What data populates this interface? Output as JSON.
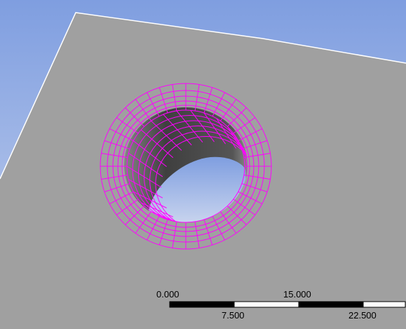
{
  "viewport": {
    "name": "3D graphics view",
    "colors": {
      "background_top": "#7f9ee0",
      "background_bottom": "#c8d4ee",
      "body_face": "#a0a0a0",
      "body_edge": "#ffffff",
      "hole_interior_dark": "#4a4a4a",
      "hole_interior_light": "#8a8a8a",
      "mesh_line": "#ff00ff"
    },
    "model": {
      "description_icon": "plate-with-hole-icon",
      "mesh_visible": true
    }
  },
  "scale_bar": {
    "labels_top": [
      "0.000",
      "15.000"
    ],
    "labels_bottom": [
      "7.500",
      "22.500"
    ],
    "segment_colors": [
      "#000000",
      "#ffffff",
      "#000000",
      "#ffffff"
    ]
  }
}
